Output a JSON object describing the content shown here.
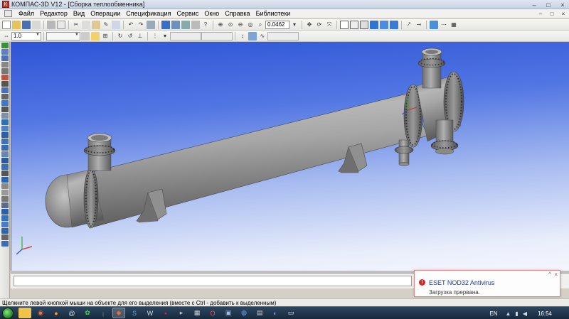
{
  "window": {
    "title": "КОМПАС-3D V12 - [Сборка теплообменника]",
    "controls": [
      "–",
      "□",
      "×"
    ]
  },
  "menu": {
    "items": [
      "Файл",
      "Редактор",
      "Вид",
      "Операции",
      "Спецификация",
      "Сервис",
      "Окно",
      "Справка",
      "Библиотеки"
    ],
    "doc_controls": [
      "–",
      "□",
      "×"
    ]
  },
  "toolbar": {
    "zoom_value": "0.0462",
    "scale_value": "1.0"
  },
  "viewport": {
    "background_top": "#2e54d6",
    "background_bottom": "#f4f6fd",
    "model_color": "#8e8e8e"
  },
  "status": {
    "text": "Щелкните левой кнопкой мыши на объекте для его выделения (вместе с Ctrl - добавить к выделенным)"
  },
  "notification": {
    "title": "ESET NOD32 Antivirus",
    "message": "Загрузка прервана.",
    "icon": "error-icon",
    "accent": "#d22b2b"
  },
  "taskbar": {
    "language": "EN",
    "time": "16:54"
  }
}
